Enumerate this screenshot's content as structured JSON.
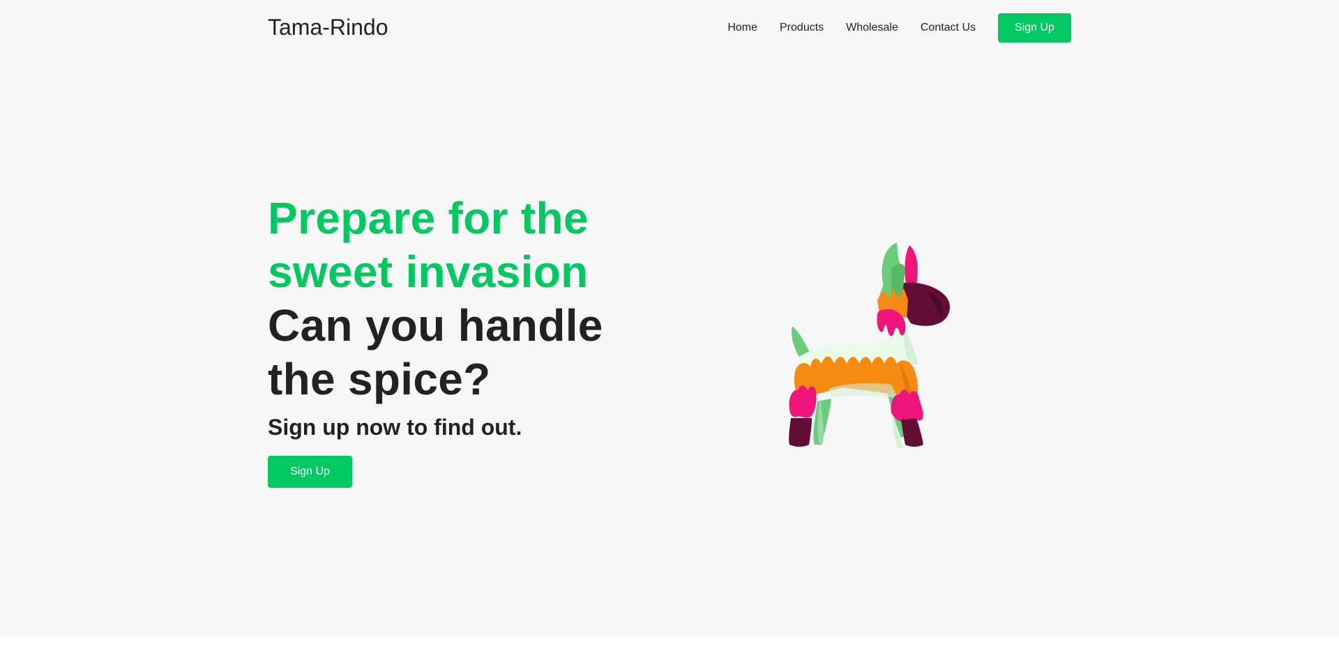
{
  "brand": {
    "name": "Tama-Rindo",
    "accent_color": "#00c962",
    "text_color": "#222222",
    "background_color": "#f7f7f7"
  },
  "nav": {
    "items": [
      {
        "label": "Home"
      },
      {
        "label": "Products"
      },
      {
        "label": "Wholesale"
      },
      {
        "label": "Contact Us"
      }
    ],
    "signup_label": "Sign Up"
  },
  "hero": {
    "headline_line1": "Prepare for the",
    "headline_line2": "sweet invasion",
    "headline_line3": "Can you handle",
    "headline_line4": "the spice?",
    "subheadline": "Sign up now to find out.",
    "signup_label": "Sign Up",
    "illustration_icon": "pinata-donkey-illustration"
  }
}
